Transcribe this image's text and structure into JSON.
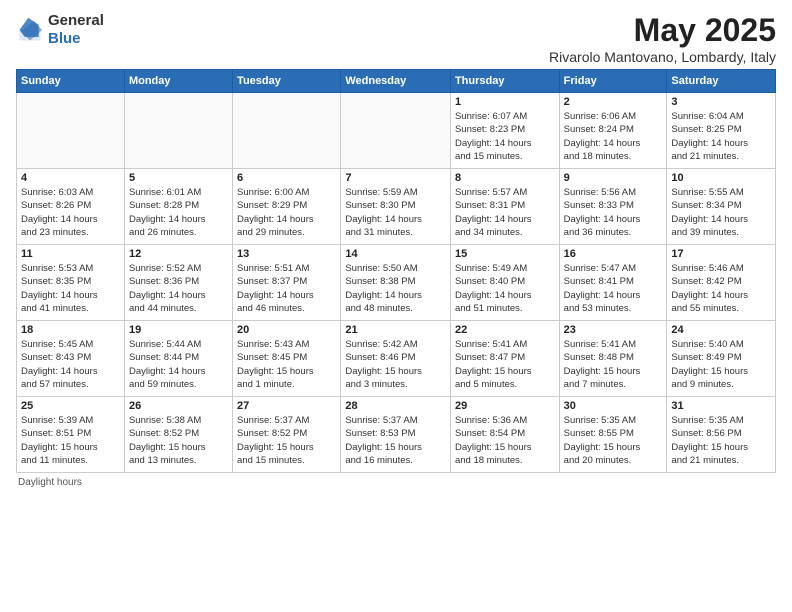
{
  "header": {
    "logo_general": "General",
    "logo_blue": "Blue",
    "month_title": "May 2025",
    "location": "Rivarolo Mantovano, Lombardy, Italy"
  },
  "weekdays": [
    "Sunday",
    "Monday",
    "Tuesday",
    "Wednesday",
    "Thursday",
    "Friday",
    "Saturday"
  ],
  "weeks": [
    [
      {
        "day": "",
        "info": ""
      },
      {
        "day": "",
        "info": ""
      },
      {
        "day": "",
        "info": ""
      },
      {
        "day": "",
        "info": ""
      },
      {
        "day": "1",
        "info": "Sunrise: 6:07 AM\nSunset: 8:23 PM\nDaylight: 14 hours\nand 15 minutes."
      },
      {
        "day": "2",
        "info": "Sunrise: 6:06 AM\nSunset: 8:24 PM\nDaylight: 14 hours\nand 18 minutes."
      },
      {
        "day": "3",
        "info": "Sunrise: 6:04 AM\nSunset: 8:25 PM\nDaylight: 14 hours\nand 21 minutes."
      }
    ],
    [
      {
        "day": "4",
        "info": "Sunrise: 6:03 AM\nSunset: 8:26 PM\nDaylight: 14 hours\nand 23 minutes."
      },
      {
        "day": "5",
        "info": "Sunrise: 6:01 AM\nSunset: 8:28 PM\nDaylight: 14 hours\nand 26 minutes."
      },
      {
        "day": "6",
        "info": "Sunrise: 6:00 AM\nSunset: 8:29 PM\nDaylight: 14 hours\nand 29 minutes."
      },
      {
        "day": "7",
        "info": "Sunrise: 5:59 AM\nSunset: 8:30 PM\nDaylight: 14 hours\nand 31 minutes."
      },
      {
        "day": "8",
        "info": "Sunrise: 5:57 AM\nSunset: 8:31 PM\nDaylight: 14 hours\nand 34 minutes."
      },
      {
        "day": "9",
        "info": "Sunrise: 5:56 AM\nSunset: 8:33 PM\nDaylight: 14 hours\nand 36 minutes."
      },
      {
        "day": "10",
        "info": "Sunrise: 5:55 AM\nSunset: 8:34 PM\nDaylight: 14 hours\nand 39 minutes."
      }
    ],
    [
      {
        "day": "11",
        "info": "Sunrise: 5:53 AM\nSunset: 8:35 PM\nDaylight: 14 hours\nand 41 minutes."
      },
      {
        "day": "12",
        "info": "Sunrise: 5:52 AM\nSunset: 8:36 PM\nDaylight: 14 hours\nand 44 minutes."
      },
      {
        "day": "13",
        "info": "Sunrise: 5:51 AM\nSunset: 8:37 PM\nDaylight: 14 hours\nand 46 minutes."
      },
      {
        "day": "14",
        "info": "Sunrise: 5:50 AM\nSunset: 8:38 PM\nDaylight: 14 hours\nand 48 minutes."
      },
      {
        "day": "15",
        "info": "Sunrise: 5:49 AM\nSunset: 8:40 PM\nDaylight: 14 hours\nand 51 minutes."
      },
      {
        "day": "16",
        "info": "Sunrise: 5:47 AM\nSunset: 8:41 PM\nDaylight: 14 hours\nand 53 minutes."
      },
      {
        "day": "17",
        "info": "Sunrise: 5:46 AM\nSunset: 8:42 PM\nDaylight: 14 hours\nand 55 minutes."
      }
    ],
    [
      {
        "day": "18",
        "info": "Sunrise: 5:45 AM\nSunset: 8:43 PM\nDaylight: 14 hours\nand 57 minutes."
      },
      {
        "day": "19",
        "info": "Sunrise: 5:44 AM\nSunset: 8:44 PM\nDaylight: 14 hours\nand 59 minutes."
      },
      {
        "day": "20",
        "info": "Sunrise: 5:43 AM\nSunset: 8:45 PM\nDaylight: 15 hours\nand 1 minute."
      },
      {
        "day": "21",
        "info": "Sunrise: 5:42 AM\nSunset: 8:46 PM\nDaylight: 15 hours\nand 3 minutes."
      },
      {
        "day": "22",
        "info": "Sunrise: 5:41 AM\nSunset: 8:47 PM\nDaylight: 15 hours\nand 5 minutes."
      },
      {
        "day": "23",
        "info": "Sunrise: 5:41 AM\nSunset: 8:48 PM\nDaylight: 15 hours\nand 7 minutes."
      },
      {
        "day": "24",
        "info": "Sunrise: 5:40 AM\nSunset: 8:49 PM\nDaylight: 15 hours\nand 9 minutes."
      }
    ],
    [
      {
        "day": "25",
        "info": "Sunrise: 5:39 AM\nSunset: 8:51 PM\nDaylight: 15 hours\nand 11 minutes."
      },
      {
        "day": "26",
        "info": "Sunrise: 5:38 AM\nSunset: 8:52 PM\nDaylight: 15 hours\nand 13 minutes."
      },
      {
        "day": "27",
        "info": "Sunrise: 5:37 AM\nSunset: 8:52 PM\nDaylight: 15 hours\nand 15 minutes."
      },
      {
        "day": "28",
        "info": "Sunrise: 5:37 AM\nSunset: 8:53 PM\nDaylight: 15 hours\nand 16 minutes."
      },
      {
        "day": "29",
        "info": "Sunrise: 5:36 AM\nSunset: 8:54 PM\nDaylight: 15 hours\nand 18 minutes."
      },
      {
        "day": "30",
        "info": "Sunrise: 5:35 AM\nSunset: 8:55 PM\nDaylight: 15 hours\nand 20 minutes."
      },
      {
        "day": "31",
        "info": "Sunrise: 5:35 AM\nSunset: 8:56 PM\nDaylight: 15 hours\nand 21 minutes."
      }
    ]
  ],
  "footer": "Daylight hours"
}
